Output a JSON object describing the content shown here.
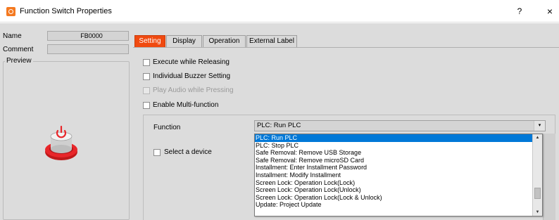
{
  "window": {
    "title": "Function Switch Properties",
    "help_label": "?",
    "close_label": "×"
  },
  "object": {
    "name_label": "Name",
    "name_value": "FB0000",
    "comment_label": "Comment",
    "comment_value": "",
    "preview_label": "Preview",
    "preview_icon": "power-button-icon"
  },
  "tabs": [
    {
      "label": "Setting",
      "active": true
    },
    {
      "label": "Display",
      "active": false
    },
    {
      "label": "Operation",
      "active": false
    },
    {
      "label": "External Label",
      "active": false
    }
  ],
  "setting": {
    "options": [
      {
        "label": "Execute while Releasing",
        "checked": false,
        "enabled": true
      },
      {
        "label": "Individual Buzzer Setting",
        "checked": false,
        "enabled": true
      },
      {
        "label": "Play Audio while Pressing",
        "checked": false,
        "enabled": false
      },
      {
        "label": "Enable Multi-function",
        "checked": false,
        "enabled": true
      }
    ],
    "function_label": "Function",
    "function_value": "PLC: Run PLC",
    "select_device_label": "Select a device",
    "function_options": [
      "PLC: Run PLC",
      "PLC: Stop PLC",
      "Safe Removal: Remove USB Storage",
      "Safe Removal: Remove microSD Card",
      "Installment: Enter Installment Password",
      "Installment: Modify Installment",
      "Screen Lock: Operation Lock(Lock)",
      "Screen Lock: Operation Lock(Unlock)",
      "Screen Lock: Operation Lock(Lock & Unlock)",
      "Update: Project Update"
    ],
    "selected_option_index": 0
  },
  "colors": {
    "active_tab": "#f04a10",
    "selection": "#0078d7",
    "app_icon": "#f47920"
  }
}
